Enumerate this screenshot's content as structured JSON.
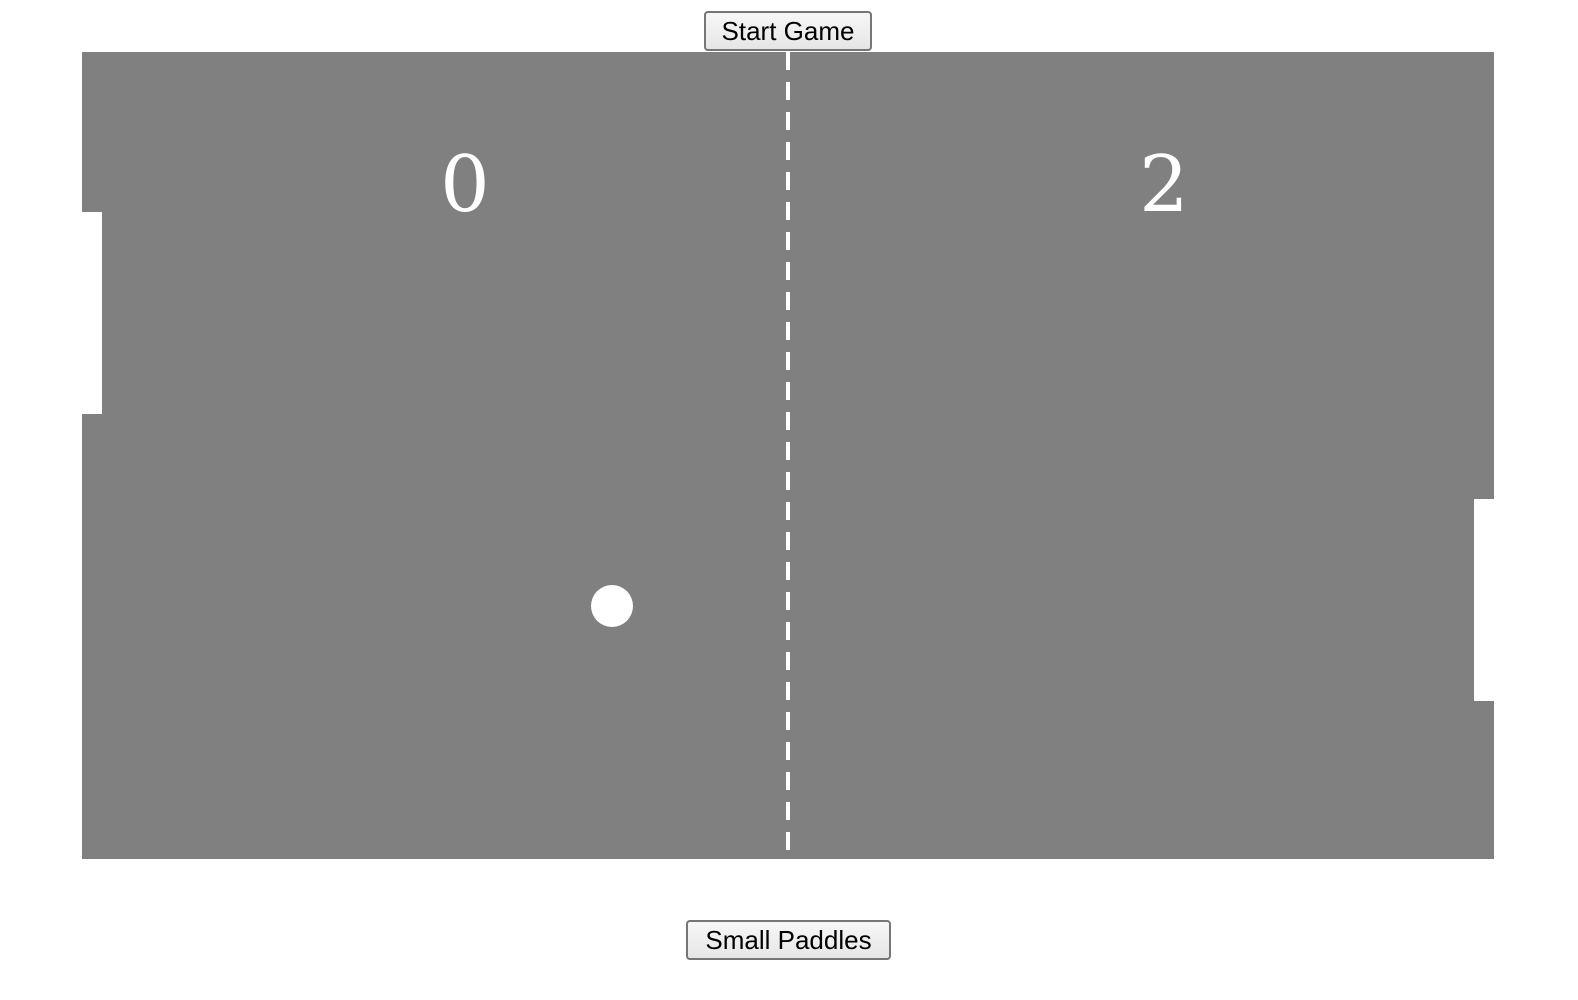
{
  "controls": {
    "start_label": "Start Game",
    "small_paddles_label": "Small Paddles"
  },
  "score": {
    "left": "0",
    "right": "2"
  },
  "colors": {
    "field": "#808080",
    "foreground": "#ffffff",
    "page_background": "#ffffff"
  }
}
